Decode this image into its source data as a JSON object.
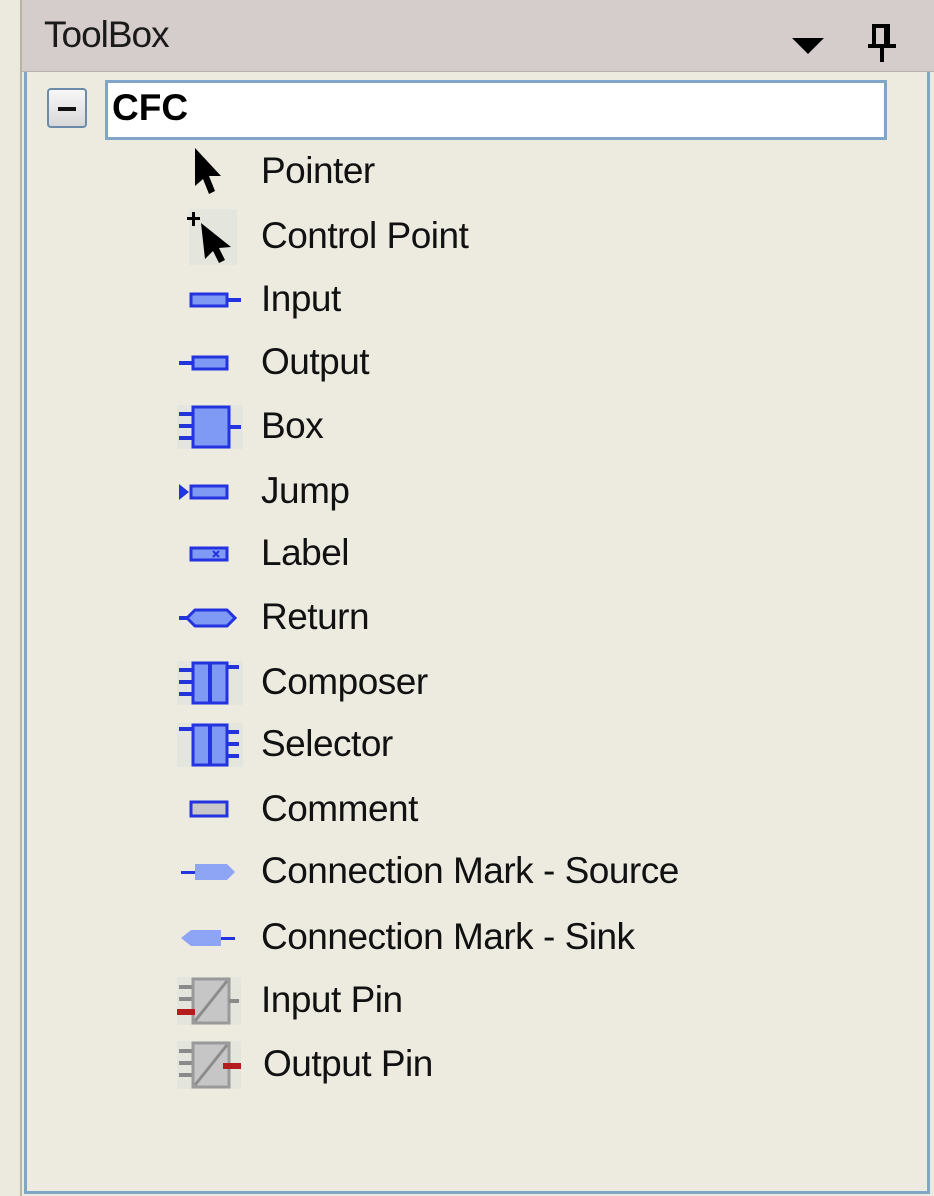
{
  "toolbox": {
    "title": "ToolBox",
    "group": {
      "label": "CFC",
      "expanded": true
    },
    "items": [
      {
        "label": "Pointer",
        "icon": "pointer-icon"
      },
      {
        "label": "Control Point",
        "icon": "control-point-icon"
      },
      {
        "label": "Input",
        "icon": "input-icon"
      },
      {
        "label": "Output",
        "icon": "output-icon"
      },
      {
        "label": "Box",
        "icon": "box-icon"
      },
      {
        "label": "Jump",
        "icon": "jump-icon"
      },
      {
        "label": "Label",
        "icon": "label-icon"
      },
      {
        "label": "Return",
        "icon": "return-icon"
      },
      {
        "label": "Composer",
        "icon": "composer-icon"
      },
      {
        "label": "Selector",
        "icon": "selector-icon"
      },
      {
        "label": "Comment",
        "icon": "comment-icon"
      },
      {
        "label": "Connection Mark - Source",
        "icon": "connection-mark-source-icon"
      },
      {
        "label": "Connection Mark - Sink",
        "icon": "connection-mark-sink-icon"
      },
      {
        "label": "Input Pin",
        "icon": "input-pin-icon"
      },
      {
        "label": "Output Pin",
        "icon": "output-pin-icon"
      }
    ]
  },
  "colors": {
    "panel_bg": "#edeae0",
    "titlebar_bg": "#d5cdcb",
    "border_blue": "#7fa6c6",
    "element_blue": "#2433e0",
    "element_fill": "#7f9af5"
  }
}
